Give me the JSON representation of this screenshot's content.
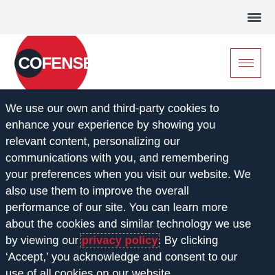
{
  "topbar": {
    "menu_icon": "hamburger-icon"
  },
  "header": {
    "logo_text": "COFENSE",
    "menu_icon": "hamburger-icon",
    "colors": {
      "brand_red": "#d81e2f",
      "logo_dark": "#1b2431"
    }
  },
  "cookie_banner": {
    "text_before_link": "We use our own and third-party cookies to enhance your experience by showing you relevant content, personalizing our communications with you, and remembering your preferences when you visit our website. We also use them to improve the overall performance of our site. You can learn more about the cookies and similar technology we use by viewing our ",
    "link_text": "privacy policy",
    "text_after_link": ". By clicking ‘Accept,’ you acknowledge and consent to our use of all cookies on our website.",
    "colors": {
      "background": "#162638",
      "text": "#ffffff",
      "link": "#d81e2f"
    }
  }
}
